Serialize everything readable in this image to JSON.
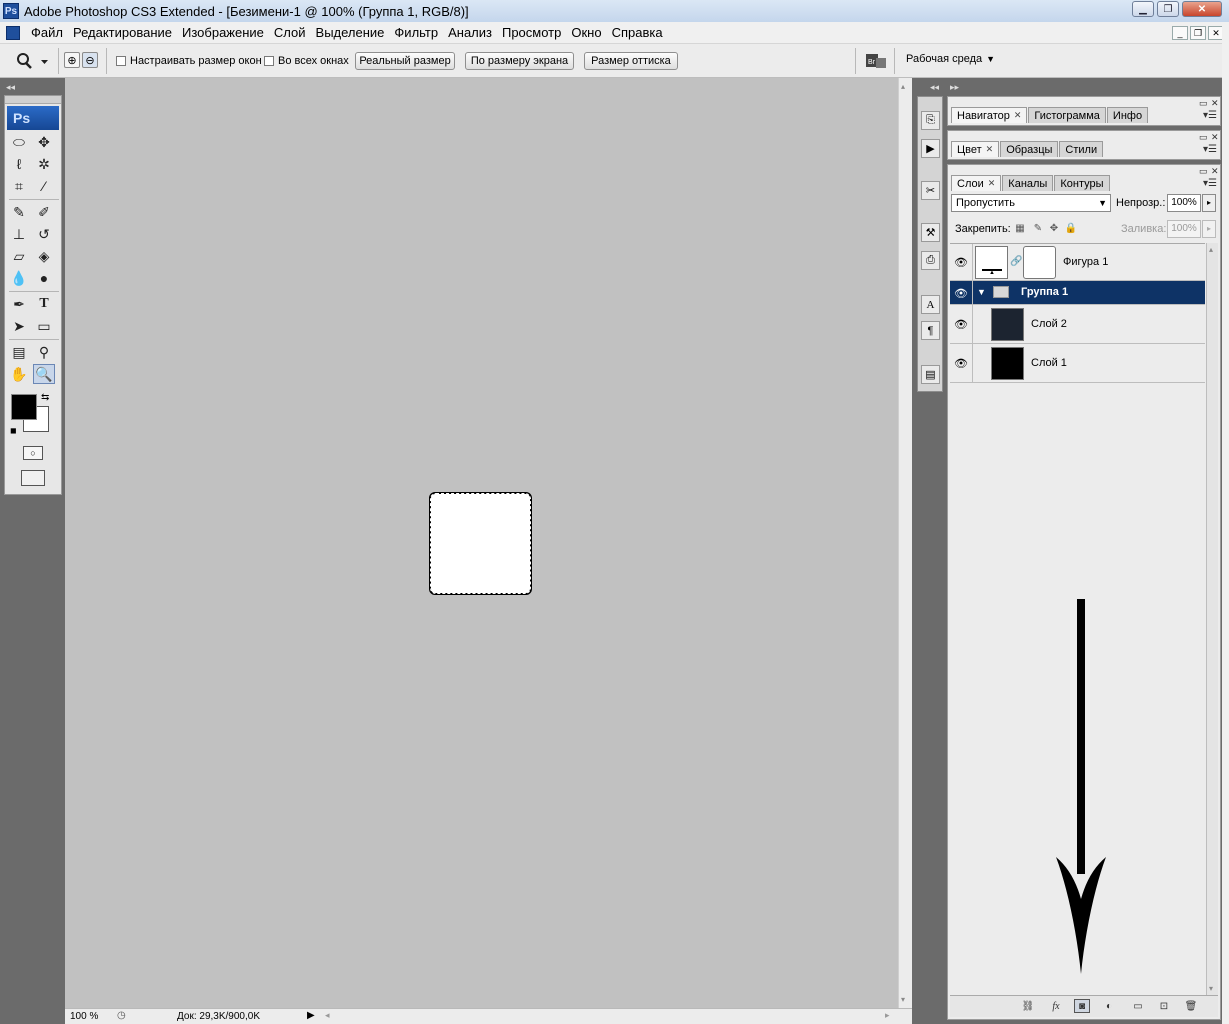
{
  "window": {
    "app_badge": "Ps",
    "title": "Adobe Photoshop CS3 Extended - [Безимени-1 @ 100% (Группа 1, RGB/8)]"
  },
  "menu": {
    "items": [
      "Файл",
      "Редактирование",
      "Изображение",
      "Слой",
      "Выделение",
      "Фильтр",
      "Анализ",
      "Просмотр",
      "Окно",
      "Справка"
    ]
  },
  "options": {
    "resize_windows_label": "Настраивать размер окон",
    "all_windows_label": "Во всех окнах",
    "actual_pixels_label": "Реальный размер",
    "fit_screen_label": "По размеру экрана",
    "print_size_label": "Размер оттиска",
    "workspace_label": "Рабочая среда"
  },
  "toolbox": {
    "logo": "Ps"
  },
  "status": {
    "zoom": "100 %",
    "doc": "Док: 29,3K/900,0K"
  },
  "panels": {
    "group1_tabs": [
      "Навигатор",
      "Гистограмма",
      "Инфо"
    ],
    "group2_tabs": [
      "Цвет",
      "Образцы",
      "Стили"
    ],
    "group3_tabs": [
      "Слои",
      "Каналы",
      "Контуры"
    ]
  },
  "layers_panel": {
    "blend_mode": "Пропустить",
    "opacity_label": "Непрозр.:",
    "opacity_value": "100%",
    "lock_label": "Закрепить:",
    "fill_label": "Заливка:",
    "fill_value": "100%",
    "layers": [
      {
        "name": "Фигура 1",
        "type": "shape"
      },
      {
        "name": "Группа 1",
        "type": "group",
        "selected": true
      },
      {
        "name": "Слой 2",
        "type": "layer"
      },
      {
        "name": "Слой 1",
        "type": "layer"
      }
    ]
  },
  "colors": {
    "selection_blue": "#0e3366",
    "canvas_gray": "#c1c1c1",
    "workspace_gray": "#6b6b6b"
  }
}
